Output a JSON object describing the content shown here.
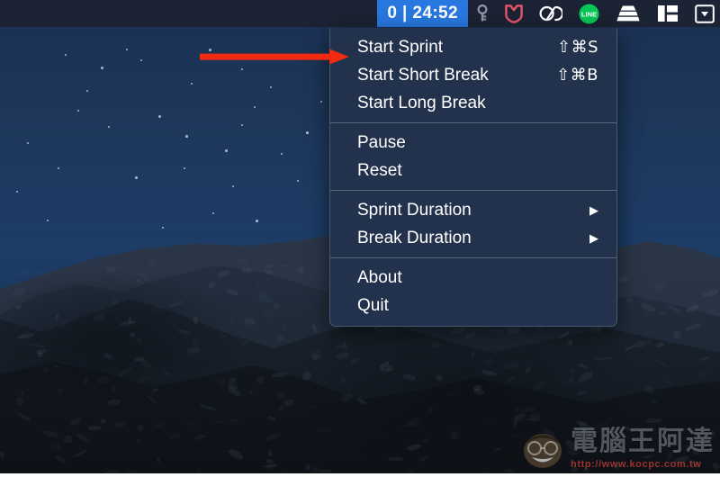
{
  "menubar": {
    "timer": {
      "name": "sprint-timer-status",
      "count": "0",
      "separator": "|",
      "time": "24:52",
      "display": "0 | 24:52",
      "background_color": "#2878e0",
      "text_color": "#ffffff"
    },
    "icons": [
      {
        "name": "key-icon",
        "label": "1Password",
        "color": "#8f97a6"
      },
      {
        "name": "mcafee-shield-icon",
        "label": "McAfee",
        "color": "#e8556b"
      },
      {
        "name": "adobe-creative-cloud-icon",
        "label": "Creative Cloud",
        "color": "#ffffff"
      },
      {
        "name": "line-icon",
        "label": "LINE",
        "text": "LINE",
        "color": "#06c755"
      },
      {
        "name": "stack-layers-icon",
        "label": "Stack",
        "color": "#ffffff"
      },
      {
        "name": "panel-layout-icon",
        "label": "Layout",
        "color": "#ffffff"
      },
      {
        "name": "boxed-dropdown-icon",
        "label": "Menu",
        "color": "#ffffff"
      }
    ],
    "background_color": "#1b2334"
  },
  "menu": {
    "name": "sprint-dropdown-menu",
    "background_color": "#23324c",
    "text_color": "#ffffff",
    "sections": [
      {
        "items": [
          {
            "label": "Start Sprint",
            "shortcut": "⇧⌘S",
            "submenu": false
          },
          {
            "label": "Start Short Break",
            "shortcut": "⇧⌘B",
            "submenu": false
          },
          {
            "label": "Start Long Break",
            "shortcut": "",
            "submenu": false
          }
        ]
      },
      {
        "items": [
          {
            "label": "Pause",
            "shortcut": "",
            "submenu": false
          },
          {
            "label": "Reset",
            "shortcut": "",
            "submenu": false
          }
        ]
      },
      {
        "items": [
          {
            "label": "Sprint Duration",
            "shortcut": "",
            "submenu": true
          },
          {
            "label": "Break Duration",
            "shortcut": "",
            "submenu": true
          }
        ]
      },
      {
        "items": [
          {
            "label": "About",
            "shortcut": "",
            "submenu": false
          },
          {
            "label": "Quit",
            "shortcut": "",
            "submenu": false
          }
        ]
      }
    ]
  },
  "annotation": {
    "name": "red-pointer-arrow",
    "color": "#f22a10",
    "points_to": "Start Sprint"
  },
  "watermark": {
    "title": "電腦王阿達",
    "url": "http://www.kocpc.com.tw"
  },
  "wallpaper": {
    "scene": "night sky with stars over mountain range",
    "sky_color": "#1d3a60",
    "mountain_color": "#232f3f"
  }
}
